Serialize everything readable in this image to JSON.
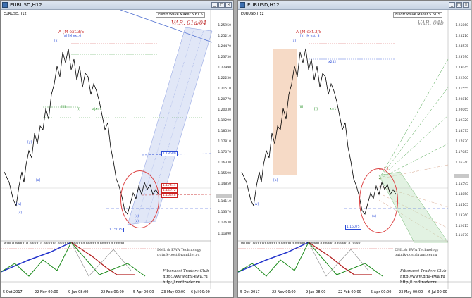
{
  "windows": [
    {
      "id": "left",
      "title": "EURUSD,H12",
      "symbol_label": "EURUSD,H12",
      "ewm_label": "Elliott Wave Maker 5.61.5",
      "variant": "VAR. 01a/04",
      "variant_color": "#c03030",
      "wave_A_label": "A [M ext.3/5",
      "wave_sub_label": "[x] [M ext.6",
      "y_labels": [
        "1.25950",
        "1.25210",
        "1.24470",
        "1.23730",
        "1.22990",
        "1.22250",
        "1.21510",
        "1.20770",
        "1.20030",
        "1.19290",
        "1.18550",
        "1.17810",
        "1.17070",
        "1.16330",
        "1.15590",
        "1.14850",
        "1.14110",
        "1.13370",
        "1.12630",
        "1.11890"
      ],
      "level_boxes": [
        {
          "text": "1.18580",
          "color": "blue"
        },
        {
          "text": "1.17414",
          "color": "red"
        },
        {
          "text": "1.16972",
          "color": "red"
        },
        {
          "text": "1.16448",
          "color": "red"
        },
        {
          "text": "1.15075",
          "color": "blue"
        }
      ],
      "wave_labels": [
        "(x)",
        "[a]",
        "[w]",
        "(v)",
        "(c)",
        "[i]",
        "[ii]",
        "[y]",
        "[v]",
        "a|x=1"
      ],
      "wlm_label": "WLM 0.00000 0.00000 0.00000 0.00000 0.00000 0.00000 0.00000 0.00000",
      "brand": "DML & EWA Technology",
      "brand_email": "putnik-post@rambler.ru",
      "fib_text": "Fibonacci Traders Club",
      "site1": "http://www.dml-ewa.ru",
      "site2": "http:// redtrader.ru",
      "x_labels": [
        "5 Oct 2017",
        "22 Nov 00:00",
        "9 Jan 08:00",
        "22 Feb 00:00",
        "5 Apr 00:00",
        "23 May 00:00",
        "6 Jul 00:00"
      ]
    },
    {
      "id": "right",
      "title": "EURUSD,H12",
      "symbol_label": "EURUSD,H12",
      "ewm_label": "Elliott Wave Maker 5.61.5",
      "variant": "VAR. 04b",
      "variant_color": "#8a8a8a",
      "wave_A_label": "A [M ext.3/5",
      "wave_sub_label": "[x] [M ext. 3",
      "y_labels": [
        "1.25860",
        "1.25210",
        "1.24535",
        "1.23790",
        "1.23045",
        "1.22300",
        "1.21555",
        "1.20810",
        "1.20065",
        "1.19320",
        "1.18575",
        "1.17830",
        "1.17085",
        "1.16340",
        "1.15595",
        "1.14850",
        "1.14105",
        "1.13360",
        "1.12615",
        "1.11870"
      ],
      "level_boxes": [
        {
          "text": "1.15075",
          "color": "blue"
        }
      ],
      "wave_labels": [
        "(x)",
        "[a]",
        "[w]",
        "(v)",
        "[i]",
        "[ii]",
        "x252",
        "x=1",
        "a=1.2"
      ],
      "wlm_label": "WLM 0.00000 0.00000 0.00000 0.00000 0.00000 0.00000 0.00000 0.00000",
      "brand": "DML & EWA Technology",
      "brand_email": "putnik-post@rambler.ru",
      "fib_text": "Fibonacci Traders Club",
      "site1": "http://www.dml-ewa.ru",
      "site2": "http:// redtrader.ru",
      "x_labels": [
        "5 Oct 2017",
        "22 Nov 00:00",
        "9 Jan 08:00",
        "22 Feb 00:00",
        "5 Apr 00:00",
        "23 May 00:00",
        "6 Jul 00:00"
      ]
    }
  ],
  "window_buttons": {
    "minimize": "_",
    "maximize": "□",
    "close": "×"
  }
}
